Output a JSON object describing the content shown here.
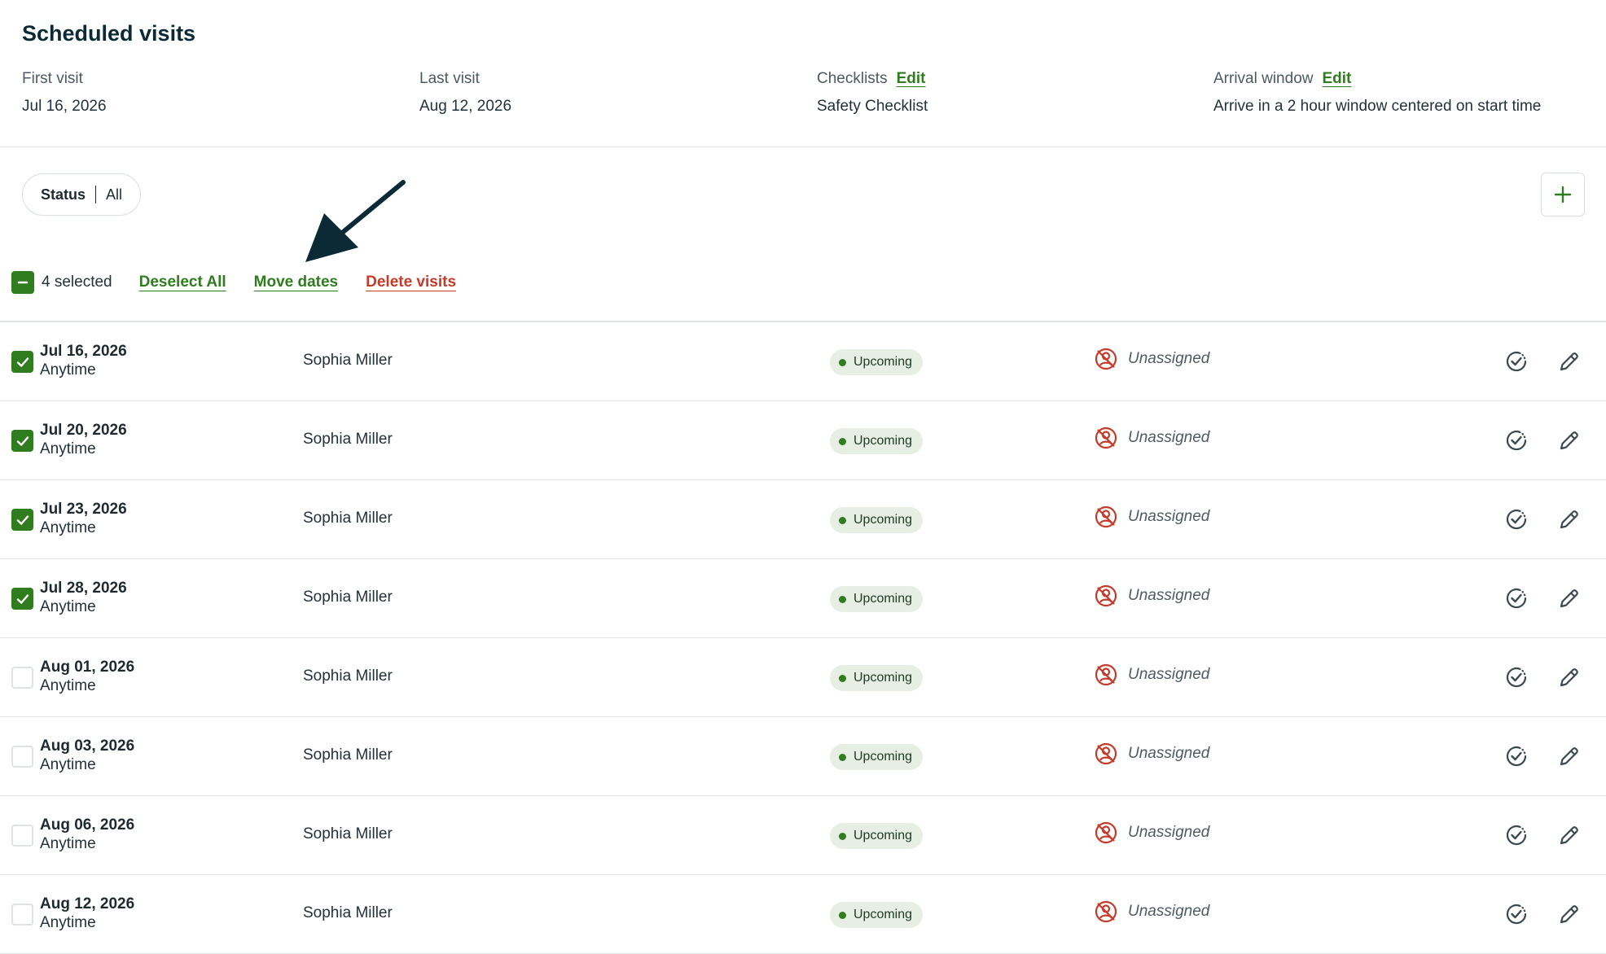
{
  "header": {
    "title": "Scheduled visits"
  },
  "summary": {
    "first_visit_label": "First visit",
    "first_visit_value": "Jul 16, 2026",
    "last_visit_label": "Last visit",
    "last_visit_value": "Aug 12, 2026",
    "checklists_label": "Checklists",
    "checklists_edit": "Edit",
    "checklists_value": "Safety Checklist",
    "arrival_label": "Arrival window",
    "arrival_edit": "Edit",
    "arrival_value": "Arrive in a 2 hour window centered on start time"
  },
  "filter": {
    "status_label": "Status",
    "status_value": "All"
  },
  "toolbar": {
    "add_icon": "plus-icon"
  },
  "bulk": {
    "selected_text": "4 selected",
    "deselect_all": "Deselect All",
    "move_dates": "Move dates",
    "delete_visits": "Delete visits"
  },
  "colors": {
    "brand_green": "#2f7d1e",
    "danger_red": "#c63a2a",
    "status_bg": "#e7efe4",
    "heading": "#0b2a36"
  },
  "visits": [
    {
      "date": "Jul 16, 2026",
      "time": "Anytime",
      "client": "Sophia Miller",
      "status": "Upcoming",
      "assignee": "Unassigned",
      "selected": true
    },
    {
      "date": "Jul 20, 2026",
      "time": "Anytime",
      "client": "Sophia Miller",
      "status": "Upcoming",
      "assignee": "Unassigned",
      "selected": true
    },
    {
      "date": "Jul 23, 2026",
      "time": "Anytime",
      "client": "Sophia Miller",
      "status": "Upcoming",
      "assignee": "Unassigned",
      "selected": true
    },
    {
      "date": "Jul 28, 2026",
      "time": "Anytime",
      "client": "Sophia Miller",
      "status": "Upcoming",
      "assignee": "Unassigned",
      "selected": true
    },
    {
      "date": "Aug 01, 2026",
      "time": "Anytime",
      "client": "Sophia Miller",
      "status": "Upcoming",
      "assignee": "Unassigned",
      "selected": false
    },
    {
      "date": "Aug 03, 2026",
      "time": "Anytime",
      "client": "Sophia Miller",
      "status": "Upcoming",
      "assignee": "Unassigned",
      "selected": false
    },
    {
      "date": "Aug 06, 2026",
      "time": "Anytime",
      "client": "Sophia Miller",
      "status": "Upcoming",
      "assignee": "Unassigned",
      "selected": false
    },
    {
      "date": "Aug 12, 2026",
      "time": "Anytime",
      "client": "Sophia Miller",
      "status": "Upcoming",
      "assignee": "Unassigned",
      "selected": false
    }
  ]
}
